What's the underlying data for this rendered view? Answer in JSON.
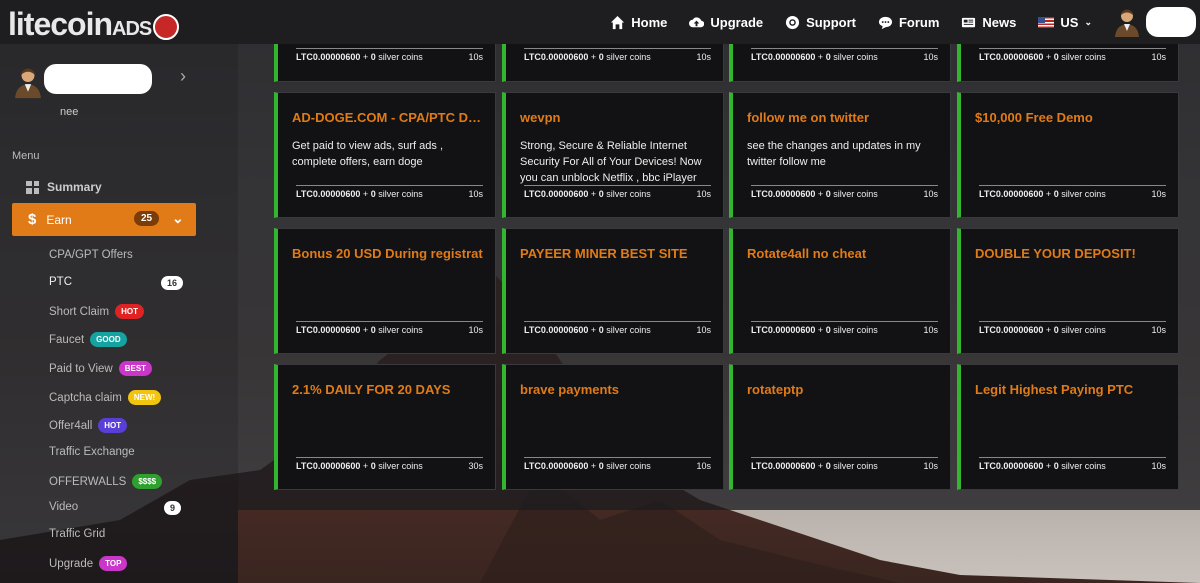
{
  "brand": {
    "name": "litecoin",
    "suffix": "ADS"
  },
  "nav": [
    {
      "label": "Home",
      "icon": "home-icon"
    },
    {
      "label": "Upgrade",
      "icon": "cloud-upload-icon"
    },
    {
      "label": "Support",
      "icon": "lifebuoy-icon"
    },
    {
      "label": "Forum",
      "icon": "chat-bubble-icon"
    },
    {
      "label": "News",
      "icon": "newspaper-icon"
    }
  ],
  "locale": {
    "label": "US"
  },
  "profile": {
    "username": "nee"
  },
  "menu": {
    "heading": "Menu",
    "summary": "Summary",
    "earn": {
      "label": "Earn",
      "count": "25"
    },
    "items": [
      {
        "label": "CPA/GPT Offers"
      },
      {
        "label": "PTC",
        "count": "16"
      },
      {
        "label": "Short Claim",
        "badge": "HOT"
      },
      {
        "label": "Faucet",
        "badge": "GOOD"
      },
      {
        "label": "Paid to View",
        "badge": "BEST"
      },
      {
        "label": "Captcha claim",
        "badge": "NEW!"
      },
      {
        "label": "Offer4all",
        "badge": "HOT"
      },
      {
        "label": "Traffic Exchange"
      },
      {
        "label": "OFFERWALLS",
        "badge": "$$$$"
      },
      {
        "label": "Video",
        "count": "9"
      },
      {
        "label": "Traffic Grid"
      },
      {
        "label": "Upgrade",
        "badge": "TOP"
      }
    ]
  },
  "reward": {
    "amount": "LTC0.00000600",
    "plus": "+",
    "coins": "0",
    "coins_label": "silver coins"
  },
  "cards": [
    {
      "title": "",
      "desc": "",
      "time": "10s"
    },
    {
      "title": "",
      "desc": "",
      "time": "10s"
    },
    {
      "title": "",
      "desc": "",
      "time": "10s"
    },
    {
      "title": "",
      "desc": "",
      "time": "10s"
    },
    {
      "title": "AD-DOGE.COM - CPA/PTC DO...",
      "desc": "Get paid to view ads, surf ads , complete offers, earn doge",
      "time": "10s"
    },
    {
      "title": "wevpn",
      "desc": "Strong, Secure & Reliable Internet Security For All of Your Devices! Now you can unblock Netflix , bbc iPlayer",
      "time": "10s"
    },
    {
      "title": "follow me on twitter",
      "desc": "see the changes and updates in my twitter follow me",
      "time": "10s"
    },
    {
      "title": "$10,000 Free Demo",
      "desc": "",
      "time": "10s"
    },
    {
      "title": "Bonus 20 USD During registrat",
      "desc": "",
      "time": "10s"
    },
    {
      "title": "PAYEER MINER BEST SITE",
      "desc": "",
      "time": "10s"
    },
    {
      "title": "Rotate4all no cheat",
      "desc": "",
      "time": "10s"
    },
    {
      "title": "DOUBLE YOUR DEPOSIT!",
      "desc": "",
      "time": "10s"
    },
    {
      "title": "2.1% DAILY FOR 20 DAYS",
      "desc": "",
      "time": "30s"
    },
    {
      "title": "brave payments",
      "desc": "",
      "time": "10s"
    },
    {
      "title": "rotateptp",
      "desc": "",
      "time": "10s"
    },
    {
      "title": "Legit Highest Paying PTC",
      "desc": "",
      "time": "10s"
    }
  ]
}
